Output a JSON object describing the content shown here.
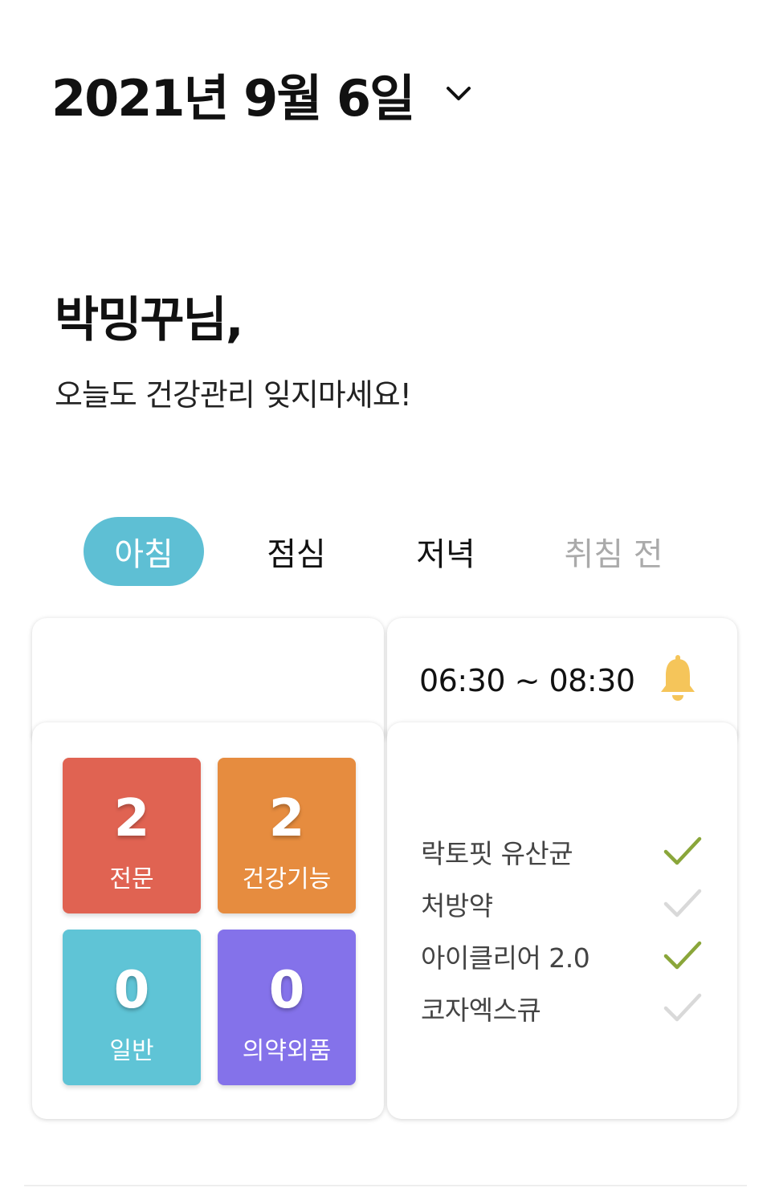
{
  "header": {
    "date": "2021년 9월 6일",
    "dropdown_icon": "chevron-down-icon"
  },
  "greeting": {
    "name": "박밍꾸님,",
    "message": "오늘도 건강관리 잊지마세요!"
  },
  "tabs": [
    {
      "label": "아침",
      "active": true
    },
    {
      "label": "점심",
      "active": false
    },
    {
      "label": "저녁",
      "active": false
    },
    {
      "label": "취침 전",
      "active": false
    }
  ],
  "schedule": {
    "time_range": "06:30 ~ 08:30",
    "alarm_icon": "bell-icon",
    "alarm_color": "#f5c55a"
  },
  "categories": [
    {
      "count": "2",
      "label": "전문",
      "color": "#e06352"
    },
    {
      "count": "2",
      "label": "건강기능",
      "color": "#e68c3f"
    },
    {
      "count": "0",
      "label": "일반",
      "color": "#5fc4d6"
    },
    {
      "count": "0",
      "label": "의약외품",
      "color": "#8472ea"
    }
  ],
  "medications": [
    {
      "name": "락토핏 유산균",
      "taken": true
    },
    {
      "name": "처방약",
      "taken": false
    },
    {
      "name": "아이클리어 2.0",
      "taken": true
    },
    {
      "name": "코자엑스큐",
      "taken": false
    }
  ],
  "colors": {
    "accent": "#5ebfd4",
    "check_taken": "#8aa63a",
    "check_untaken": "#d9d9d9"
  }
}
